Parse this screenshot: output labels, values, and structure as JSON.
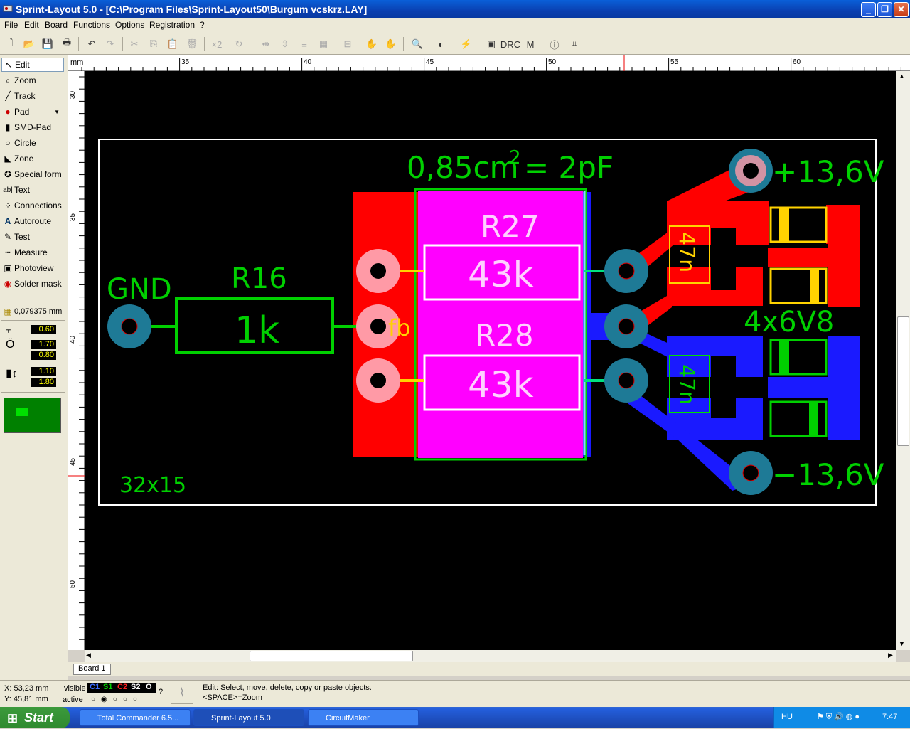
{
  "window": {
    "title": "Sprint-Layout 5.0 - [C:\\Program Files\\Sprint-Layout50\\Burgum vcskrz.LAY]"
  },
  "menu": [
    "File",
    "Edit",
    "Board",
    "Functions",
    "Options",
    "Registration",
    "?"
  ],
  "tools": [
    {
      "label": "Edit",
      "icon": "arrow-pointer-icon"
    },
    {
      "label": "Zoom",
      "icon": "magnifier-icon"
    },
    {
      "label": "Track",
      "icon": "track-icon"
    },
    {
      "label": "Pad",
      "icon": "pad-icon"
    },
    {
      "label": "SMD-Pad",
      "icon": "smd-pad-icon"
    },
    {
      "label": "Circle",
      "icon": "circle-icon"
    },
    {
      "label": "Zone",
      "icon": "zone-icon"
    },
    {
      "label": "Special form",
      "icon": "special-form-icon"
    },
    {
      "label": "Text",
      "icon": "text-icon"
    },
    {
      "label": "Connections",
      "icon": "connections-icon"
    },
    {
      "label": "Autoroute",
      "icon": "autoroute-icon"
    },
    {
      "label": "Test",
      "icon": "test-icon"
    },
    {
      "label": "Measure",
      "icon": "measure-icon"
    },
    {
      "label": "Photoview",
      "icon": "camera-icon"
    },
    {
      "label": "Solder mask",
      "icon": "solder-mask-icon"
    }
  ],
  "grid": "0,079375 mm",
  "params": {
    "track_width": "0.60",
    "pad_outer": "1.70",
    "pad_inner": "0.80",
    "smd_w": "1.10",
    "smd_h": "1.80"
  },
  "ruler": {
    "unit": "mm",
    "h_ticks": [
      "35",
      "40",
      "45",
      "50",
      "55",
      "60"
    ],
    "v_ticks": [
      "30",
      "35",
      "40",
      "45",
      "50"
    ]
  },
  "board_texts": {
    "gnd": "GND",
    "r16": "R16",
    "r16_val": "1k",
    "fb": "fb",
    "cap_formula": "0,85cm",
    "cap_sup": "2",
    "cap_val": "= 2pF",
    "r27": "R27",
    "r27_val": "43k",
    "r28": "R28",
    "r28_val": "43k",
    "vplus": "+13,6V",
    "vminus": "−13,6V",
    "zener": "4x6V8",
    "cap1": "47n",
    "cap2": "47n",
    "size": "32x15"
  },
  "colors": {
    "copper_top": "#ff0000",
    "copper_bottom": "#1a1aff",
    "silk": "#00c800",
    "magenta": "#ff00ff",
    "pad": "#1e7a96",
    "yellow": "#ffd200"
  },
  "tab": "Board 1",
  "status": {
    "x": "X:  53,23 mm",
    "y": "Y:  45,81 mm",
    "visible_label": "visible",
    "active_label": "active",
    "layers": [
      "C1",
      "S1",
      "C2",
      "S2",
      "O"
    ],
    "help1": "Edit: Select, move, delete, copy or paste objects.",
    "help2": "<SPACE>=Zoom"
  },
  "taskbar": {
    "start": "Start",
    "items": [
      "Total Commander 6.5...",
      "Sprint-Layout 5.0",
      "CircuitMaker"
    ],
    "lang": "HU",
    "clock": "7:47"
  }
}
